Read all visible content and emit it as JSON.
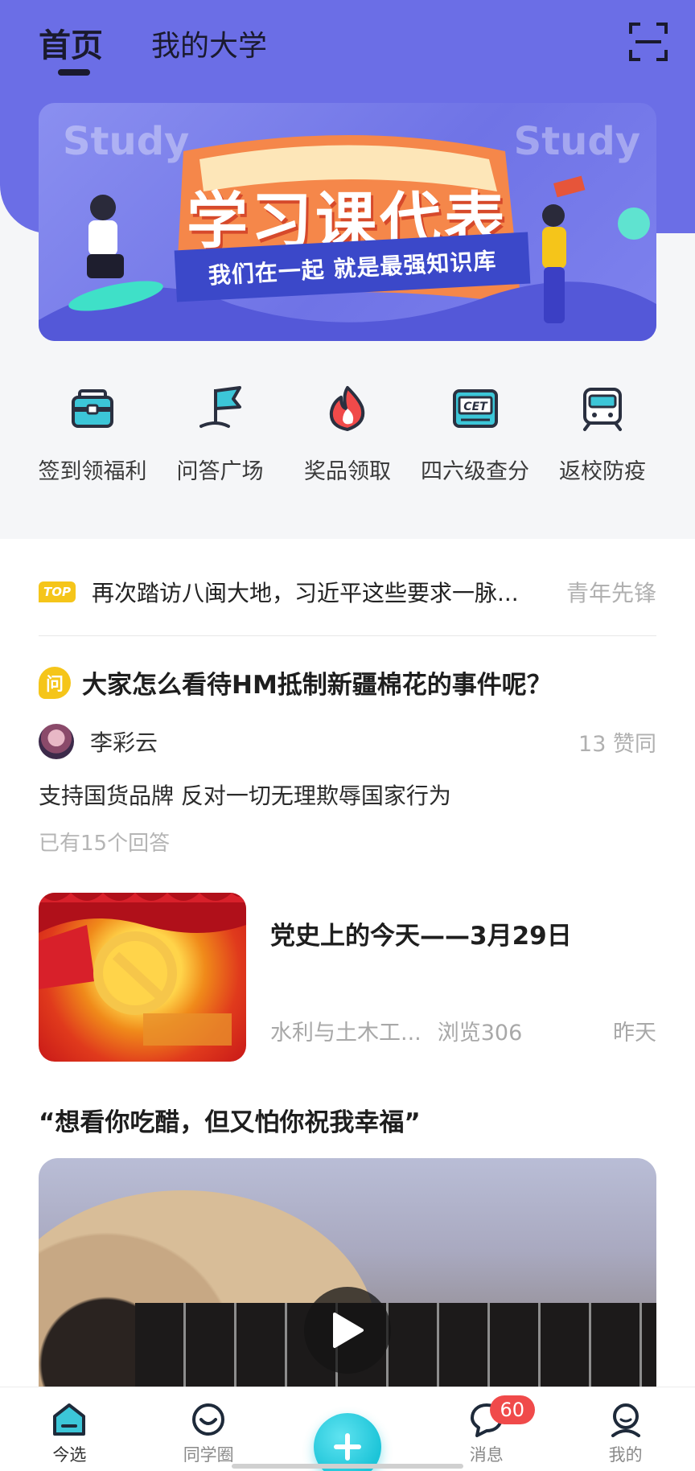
{
  "header": {
    "tab_home": "首页",
    "tab_university": "我的大学",
    "scan_icon": "scan-icon"
  },
  "banner": {
    "bg_text_left": "Study",
    "bg_text_right": "Study",
    "headline": "学习课代表",
    "ribbon": "我们在一起 就是最强知识库"
  },
  "quick_entries": [
    {
      "label": "签到领福利",
      "icon": "briefcase-icon"
    },
    {
      "label": "问答广场",
      "icon": "flag-icon"
    },
    {
      "label": "奖品领取",
      "icon": "flame-icon"
    },
    {
      "label": "四六级查分",
      "icon": "cet-icon"
    },
    {
      "label": "返校防疫",
      "icon": "train-icon"
    }
  ],
  "top_news": {
    "badge": "TOP",
    "title": "再次踏访八闽大地，习近平这些要求一脉...",
    "source": "青年先锋"
  },
  "qa": {
    "badge": "问",
    "title": "大家怎么看待HM抵制新疆棉花的事件呢？",
    "author": "李彩云",
    "likes": "13 赞同",
    "answer": "支持国货品牌  反对一切无理欺辱国家行为",
    "answer_count": "已有15个回答"
  },
  "article": {
    "title": "党史上的今天——3月29日",
    "department": "水利与土木工...",
    "views": "浏览306",
    "time": "昨天"
  },
  "video": {
    "title": "“想看你吃醋，但又怕你祝我幸福”"
  },
  "bottom_nav": {
    "items": [
      {
        "label": "今选",
        "icon": "home-icon"
      },
      {
        "label": "同学圈",
        "icon": "smile-icon"
      },
      {
        "label": "",
        "icon": "plus-icon"
      },
      {
        "label": "消息",
        "icon": "chat-icon",
        "badge": "60"
      },
      {
        "label": "我的",
        "icon": "user-icon"
      }
    ]
  },
  "colors": {
    "primary": "#6b6ee6",
    "accent_cyan": "#1cc4d8",
    "badge_yellow": "#f5c51a",
    "badge_red": "#f04a4a"
  }
}
